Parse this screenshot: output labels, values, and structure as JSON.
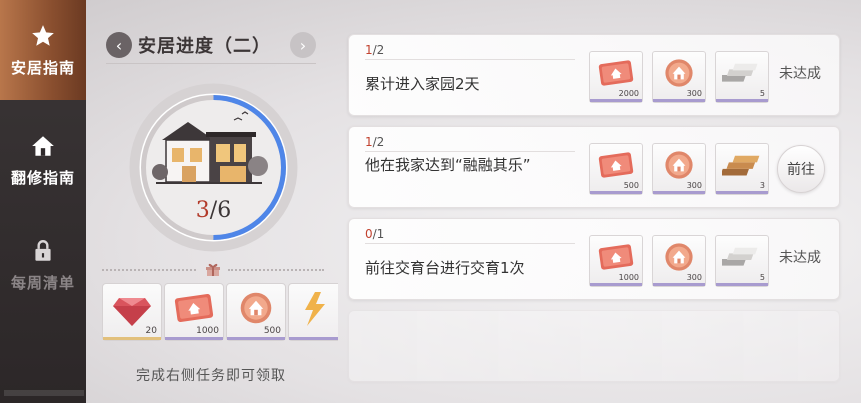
{
  "sidebar": {
    "items": [
      {
        "label": "安居指南",
        "icon": "star-icon",
        "active": true
      },
      {
        "label": "翻修指南",
        "icon": "house-icon",
        "active": false
      },
      {
        "label": "每周清单",
        "icon": "lock-icon",
        "active": false,
        "locked": true
      }
    ]
  },
  "progress_panel": {
    "title": "安居进度（二）",
    "current": "3",
    "total": "/6",
    "progress_fraction": 0.5,
    "rewards": [
      {
        "icon": "gem-icon",
        "count": "20",
        "rarity": "gold"
      },
      {
        "icon": "home-ticket-icon",
        "count": "1000",
        "rarity": "purple"
      },
      {
        "icon": "home-coin-icon",
        "count": "500",
        "rarity": "purple"
      },
      {
        "icon": "partial-item-icon",
        "count": "",
        "rarity": "purple"
      }
    ],
    "claim_text": "完成右侧任务即可领取"
  },
  "tasks": [
    {
      "progress_current": "1",
      "progress_total": "/2",
      "description": "累计进入家园2天",
      "rewards": [
        {
          "icon": "home-ticket-icon",
          "count": "2000"
        },
        {
          "icon": "home-coin-icon",
          "count": "300"
        },
        {
          "icon": "silver-bars-icon",
          "count": "5"
        }
      ],
      "status": "未达成"
    },
    {
      "progress_current": "1",
      "progress_total": "/2",
      "description": "他在我家达到“融融其乐”",
      "rewards": [
        {
          "icon": "home-ticket-icon",
          "count": "500"
        },
        {
          "icon": "home-coin-icon",
          "count": "300"
        },
        {
          "icon": "wood-planks-icon",
          "count": "3"
        }
      ],
      "go_label": "前往"
    },
    {
      "progress_current": "0",
      "progress_total": "/1",
      "description": "前往交育台进行交育1次",
      "rewards": [
        {
          "icon": "home-ticket-icon",
          "count": "1000"
        },
        {
          "icon": "home-coin-icon",
          "count": "300"
        },
        {
          "icon": "silver-bars-icon",
          "count": "5"
        }
      ],
      "status": "未达成"
    }
  ],
  "colors": {
    "accent_red": "#c2422f",
    "progress_blue": "#4f86e8",
    "sidebar_active": "#a8643e",
    "rarity_purple": "#a89bcf"
  }
}
